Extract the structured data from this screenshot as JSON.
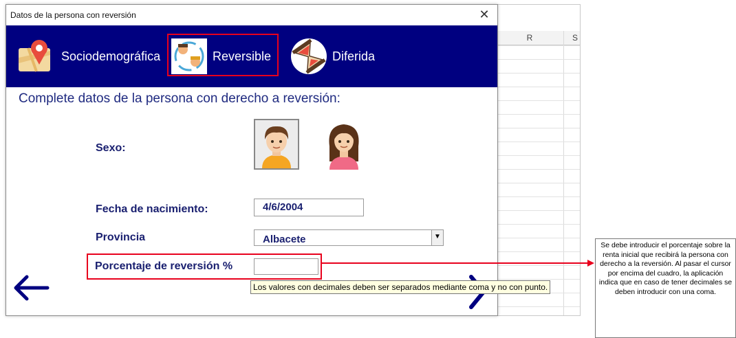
{
  "sheet": {
    "columns": [
      "R",
      "S"
    ]
  },
  "dialog": {
    "title": "Datos de la persona con reversión",
    "close": "✕",
    "tabs": [
      {
        "label": "Sociodemográfica",
        "icon": "map-pin-icon"
      },
      {
        "label": "Reversible",
        "icon": "person-exchange-icon"
      },
      {
        "label": "Diferida",
        "icon": "hourglass-icon"
      }
    ],
    "subtitle": "Complete datos de la persona con derecho a reversión:",
    "sexo_label": "Sexo:",
    "fecha_label": "Fecha de nacimiento:",
    "fecha_value": "4/6/2004",
    "provincia_label": "Provincia",
    "provincia_value": "Albacete",
    "porcentaje_label": "Porcentaje de reversión %",
    "porcentaje_value": "",
    "tooltip": "Los valores con decimales deben ser separados mediante coma y no con punto."
  },
  "note": "Se debe introducir el porcentaje sobre la renta inicial que recibirá la persona con derecho a la reversión. Al pasar el cursor por encima del cuadro, la aplicación indica que en caso de tener decimales se deben introducir con una coma.",
  "colors": {
    "nav": "#000080",
    "highlight": "#e8001c",
    "label": "#1a2070"
  }
}
